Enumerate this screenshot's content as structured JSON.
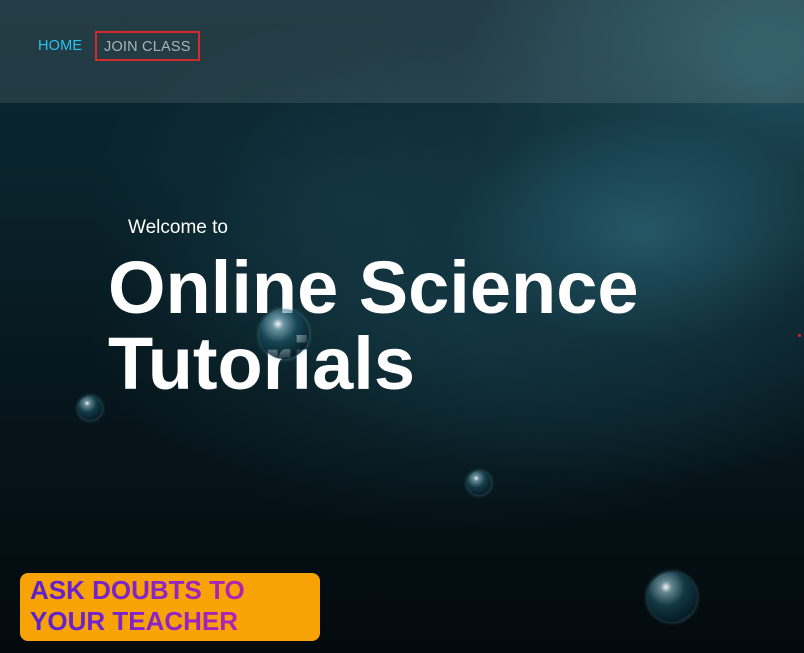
{
  "nav": {
    "home_label": "HOME",
    "join_class_label": "JOIN CLASS"
  },
  "hero": {
    "welcome": "Welcome to",
    "title": "Online Science Tutorials"
  },
  "cta": {
    "label": "ASK DOUBTS TO YOUR TEACHER"
  },
  "colors": {
    "nav_active": "#29c4f2",
    "nav_inactive": "#a9b4b7",
    "highlight_border": "#d42a2a",
    "cta_background": "#f7a305",
    "cta_text_start": "#5a1fd0",
    "cta_text_end": "#d81f9b"
  }
}
